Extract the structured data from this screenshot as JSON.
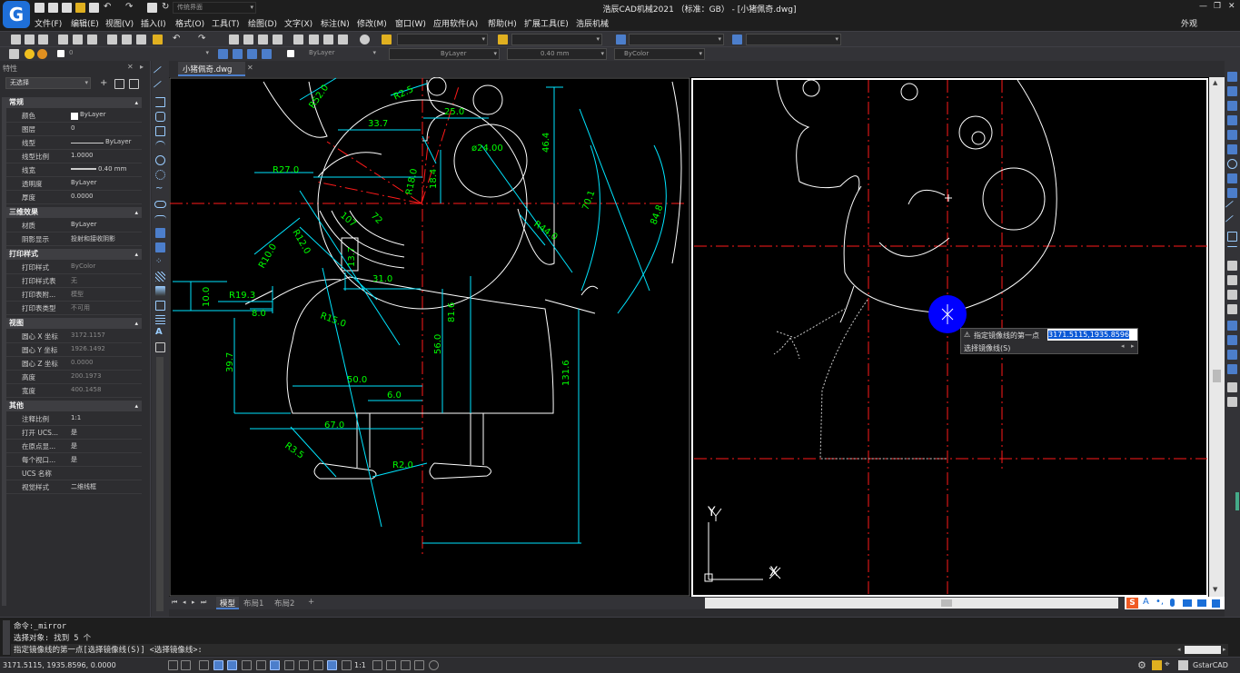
{
  "app": {
    "title": "浩辰CAD机械2021 （标准：GB） - [小猪佩奇.dwg]",
    "workspace": "传统界面",
    "appearance": "外观",
    "logo": "G",
    "window_controls": [
      "—",
      "❐",
      "✕"
    ]
  },
  "menu": [
    "文件(F)",
    "编辑(E)",
    "视图(V)",
    "插入(I)",
    "格式(O)",
    "工具(T)",
    "绘图(D)",
    "文字(X)",
    "标注(N)",
    "修改(M)",
    "窗口(W)",
    "应用软件(A)",
    "帮助(H)",
    "扩展工具(E)",
    "浩辰机械"
  ],
  "layer_bar": {
    "current_layer": "0",
    "color": "ByLayer",
    "linetype": "ByLayer",
    "lineweight": "0.40 mm",
    "plotstyle": "ByColor"
  },
  "properties": {
    "panel_title": "特性",
    "selection": "无选择",
    "sections": [
      {
        "title": "常规",
        "rows": [
          {
            "label": "颜色",
            "value": "ByLayer"
          },
          {
            "label": "图层",
            "value": "0"
          },
          {
            "label": "线型",
            "value": "ByLayer"
          },
          {
            "label": "线型比例",
            "value": "1.0000"
          },
          {
            "label": "线宽",
            "value": "0.40 mm"
          },
          {
            "label": "透明度",
            "value": "ByLayer"
          },
          {
            "label": "厚度",
            "value": "0.0000"
          }
        ]
      },
      {
        "title": "三维效果",
        "rows": [
          {
            "label": "材质",
            "value": "ByLayer"
          },
          {
            "label": "阴影显示",
            "value": "投射和接收阴影"
          }
        ]
      },
      {
        "title": "打印样式",
        "rows": [
          {
            "label": "打印样式",
            "value": "ByColor"
          },
          {
            "label": "打印样式表",
            "value": "无"
          },
          {
            "label": "打印表附...",
            "value": "模型"
          },
          {
            "label": "打印表类型",
            "value": "不可用"
          }
        ]
      },
      {
        "title": "视图",
        "rows": [
          {
            "label": "圆心 X 坐标",
            "value": "3172.1157"
          },
          {
            "label": "圆心 Y 坐标",
            "value": "1926.1492"
          },
          {
            "label": "圆心 Z 坐标",
            "value": "0.0000"
          },
          {
            "label": "高度",
            "value": "200.1973"
          },
          {
            "label": "宽度",
            "value": "400.1458"
          }
        ]
      },
      {
        "title": "其他",
        "rows": [
          {
            "label": "注释比例",
            "value": "1:1"
          },
          {
            "label": "打开 UCS...",
            "value": "是"
          },
          {
            "label": "在原点显...",
            "value": "是"
          },
          {
            "label": "每个视口...",
            "value": "是"
          },
          {
            "label": "UCS 名称",
            "value": ""
          },
          {
            "label": "视觉样式",
            "value": "二维线框"
          }
        ]
      }
    ]
  },
  "doc_tab": "小猪佩奇.dwg",
  "layout_tabs": [
    "模型",
    "布局1",
    "布局2",
    "+"
  ],
  "dimensions": {
    "r520": "R52.0",
    "r25": "R2.5",
    "d337": "33.7",
    "d250": "25.0",
    "d240": "ø24.00",
    "d464": "46.4",
    "r270": "R27.0",
    "r180": "R18.0",
    "d184": "18.4",
    "r440": "R44.0",
    "d701": "70.1",
    "d848": "84.8",
    "d107": "107",
    "d72": "72",
    "r100": "R10.0",
    "r120": "R12.0",
    "d137": "13.7",
    "d310": "31.0",
    "d100": "10.0",
    "r193": "R19.3",
    "d80": "8.0",
    "r150": "R15.0",
    "d816": "81.6",
    "d560": "56.0",
    "d397": "39.7",
    "d500": "50.0",
    "d60": "6.0",
    "d1316": "131.6",
    "d670": "67.0",
    "r35": "R3.5",
    "r20": "R2.0"
  },
  "prompt": {
    "label": "指定镜像线的第一点",
    "value": "3171.5115,1935.8596",
    "option": "选择镜像线(S)"
  },
  "axes": {
    "x": "X",
    "y": "Y"
  },
  "command_lines": [
    "命令:_mirror",
    "选择对象: 找到 5 个",
    "指定镜像线的第一点[选择镜像线(S)] <选择镜像线>:"
  ],
  "status": {
    "coords": "3171.5115, 1935.8596, 0.0000",
    "scale": "1:1",
    "brand": "GstarCAD"
  },
  "colors": {
    "accent": "#4c7ecb",
    "dimension": "#00ff00",
    "cyan": "#00e5ff",
    "center": "#ff1a1a",
    "cursor": "#0000ff"
  }
}
